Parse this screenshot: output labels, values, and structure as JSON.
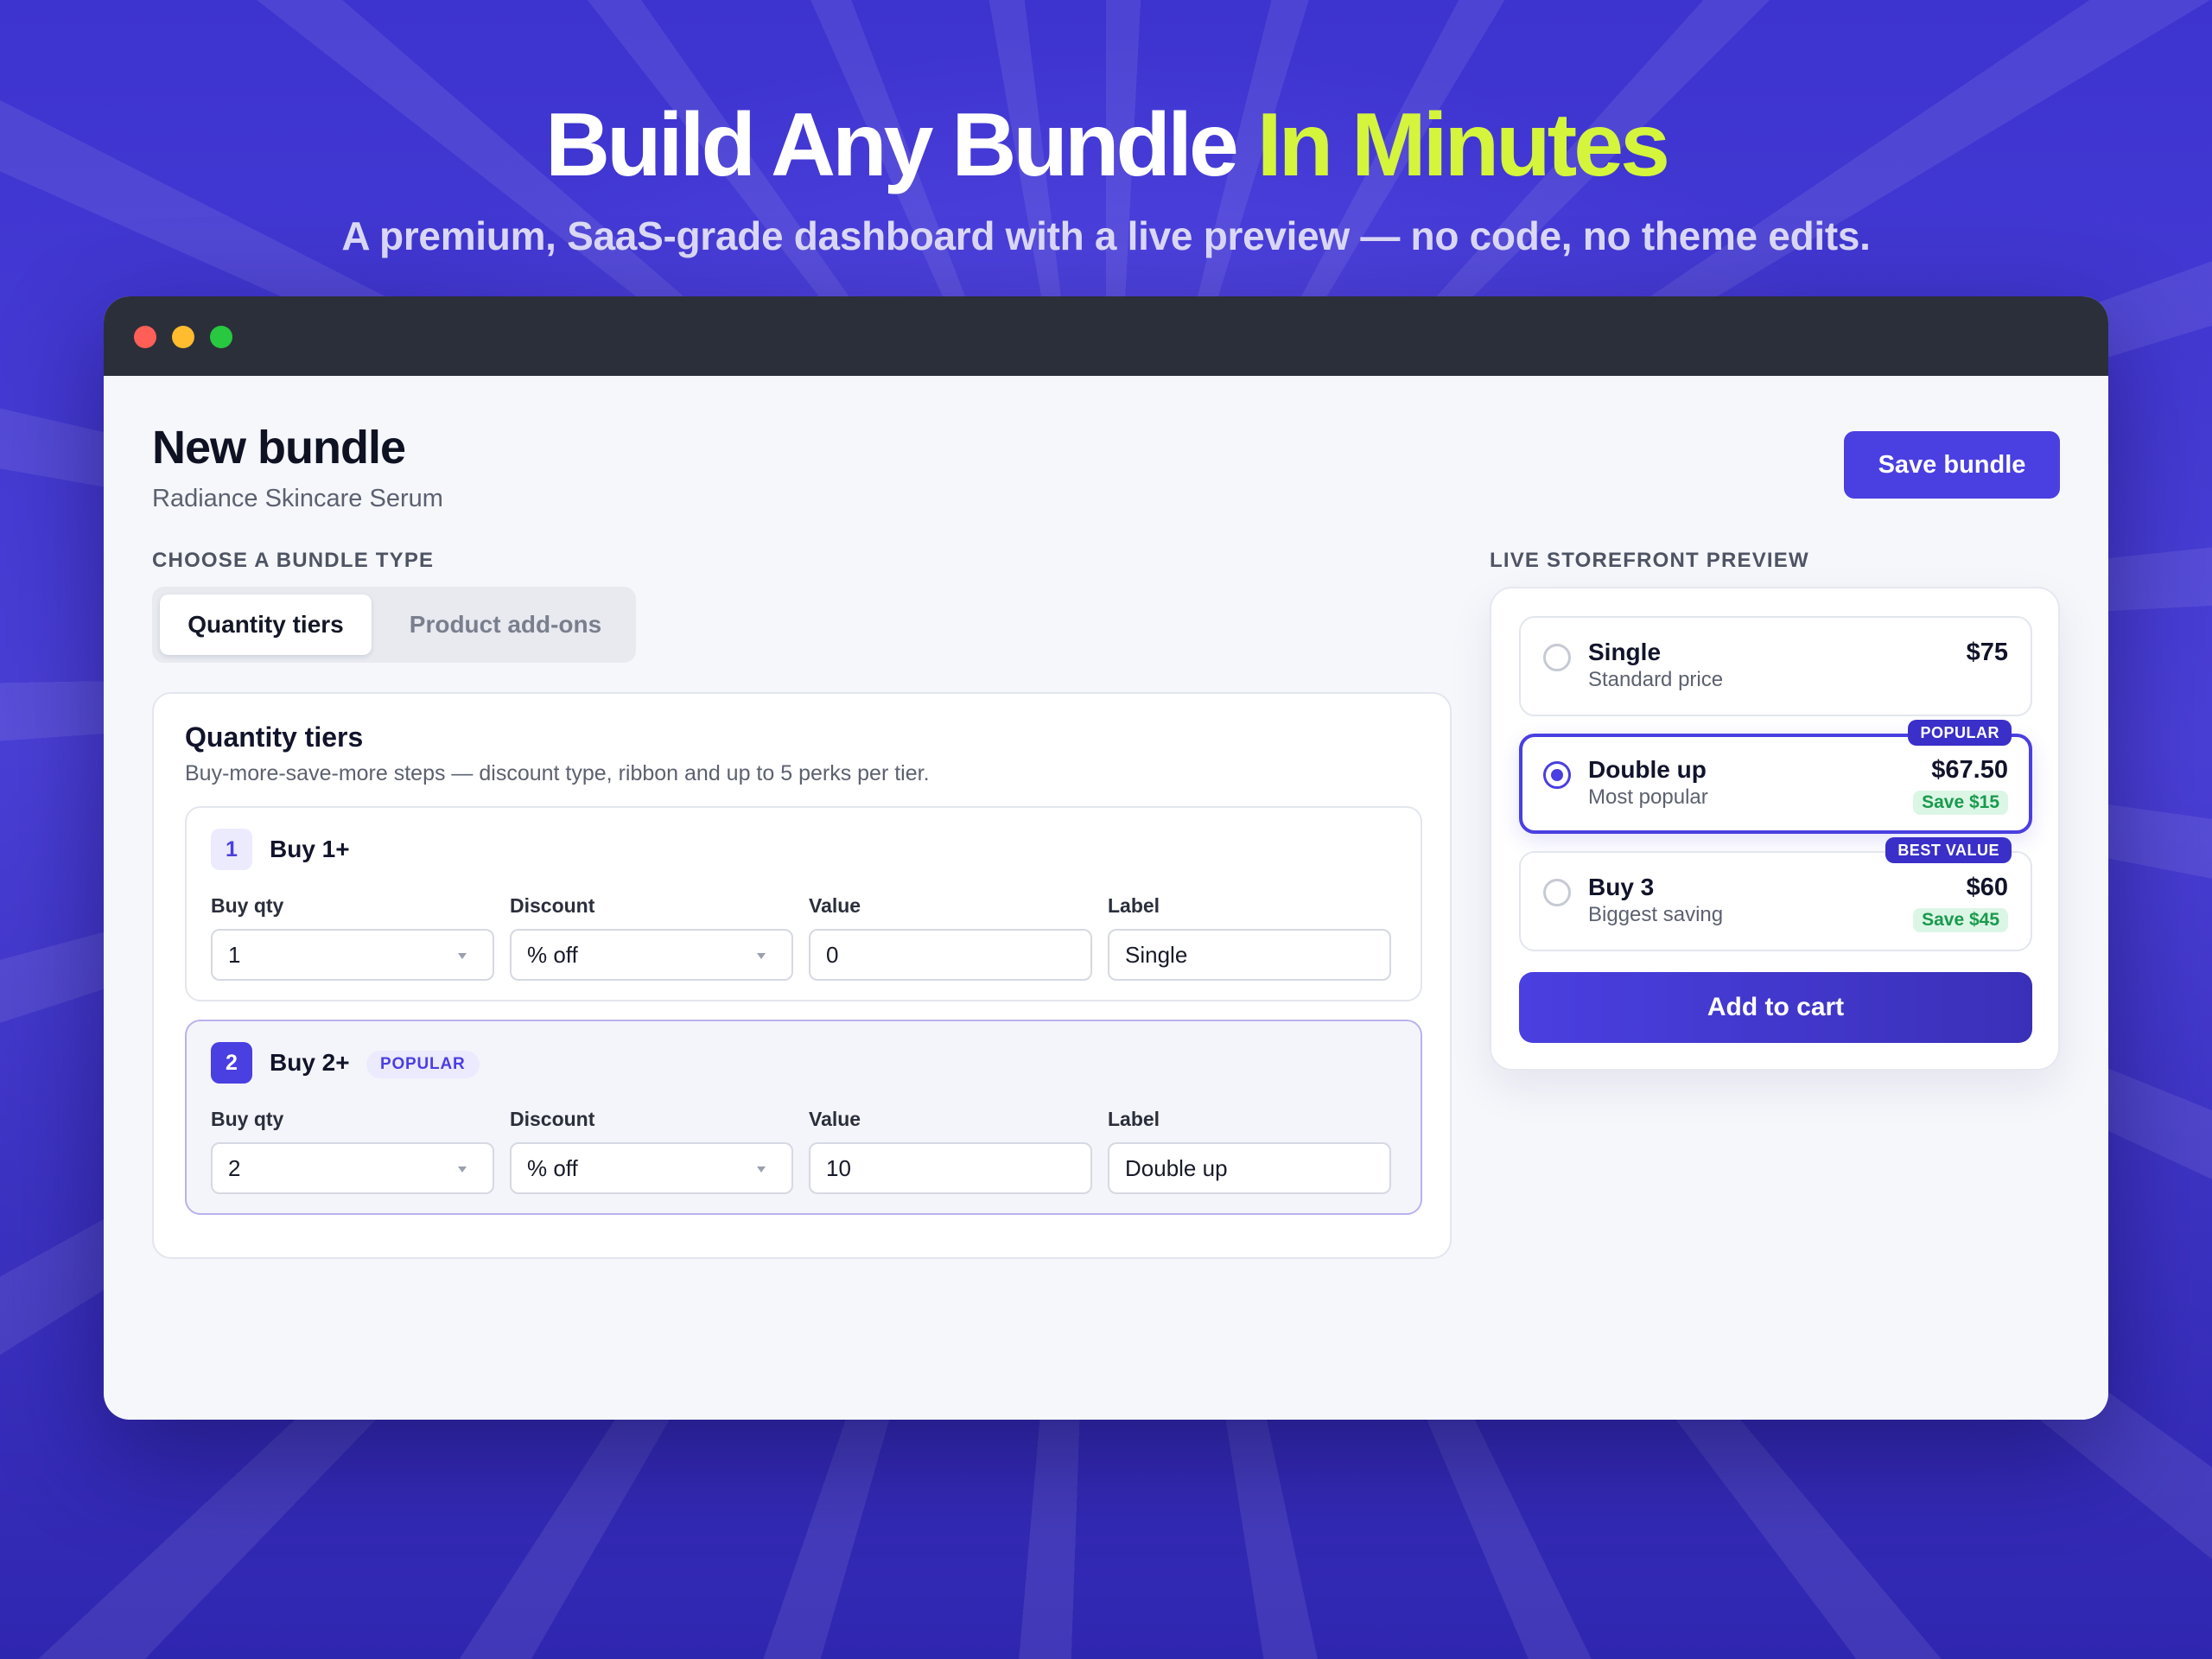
{
  "hero": {
    "title_main": "Build Any Bundle",
    "title_accent": "In Minutes",
    "subtitle": "A premium, SaaS-grade dashboard with a live preview — no code, no theme edits."
  },
  "page": {
    "title": "New bundle",
    "subtitle": "Radiance Skincare Serum",
    "save_label": "Save bundle"
  },
  "bundle_type": {
    "label": "CHOOSE A BUNDLE TYPE",
    "tabs": [
      {
        "label": "Quantity tiers",
        "active": true
      },
      {
        "label": "Product add-ons",
        "active": false
      }
    ]
  },
  "tiers_card": {
    "title": "Quantity tiers",
    "description": "Buy-more-save-more steps — discount type, ribbon and up to 5 perks per tier.",
    "tiers": [
      {
        "number": "1",
        "name": "Buy 1+",
        "badge": "",
        "fields": {
          "buy_qty_label": "Buy qty",
          "buy_qty": "1",
          "discount_label": "Discount",
          "discount": "% off",
          "value_label": "Value",
          "value": "0",
          "label_label": "Label",
          "label": "Single"
        }
      },
      {
        "number": "2",
        "name": "Buy 2+",
        "badge": "POPULAR",
        "fields": {
          "buy_qty_label": "Buy qty",
          "buy_qty": "2",
          "discount_label": "Discount",
          "discount": "% off",
          "value_label": "Value",
          "value": "10",
          "label_label": "Label",
          "label": "Double up"
        }
      }
    ]
  },
  "preview": {
    "label": "LIVE STOREFRONT PREVIEW",
    "options": [
      {
        "title": "Single",
        "subtitle": "Standard price",
        "price": "$75",
        "save": "",
        "ribbon": "",
        "selected": false
      },
      {
        "title": "Double up",
        "subtitle": "Most popular",
        "price": "$67.50",
        "save": "Save $15",
        "ribbon": "POPULAR",
        "selected": true
      },
      {
        "title": "Buy 3",
        "subtitle": "Biggest saving",
        "price": "$60",
        "save": "Save $45",
        "ribbon": "BEST VALUE",
        "selected": false
      }
    ],
    "cart_label": "Add to cart"
  },
  "colors": {
    "accent": "#4a3fe0",
    "hero_accent": "#d4f53c",
    "save_green": "#1a9a4d"
  }
}
